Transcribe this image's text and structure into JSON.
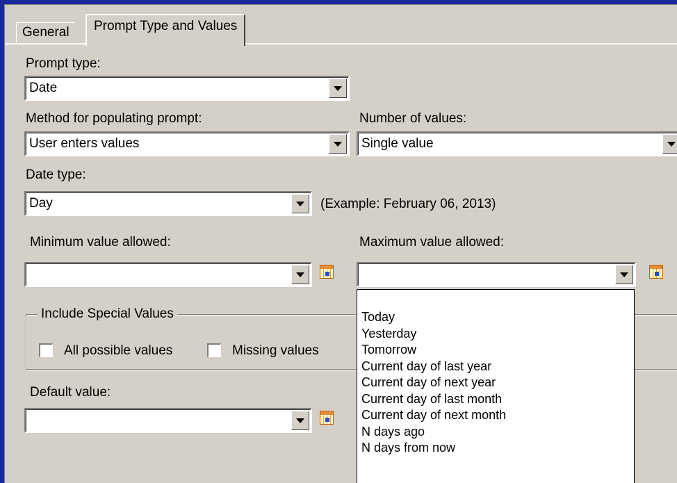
{
  "tabs": [
    {
      "label": "General",
      "active": false
    },
    {
      "label": "Prompt Type and Values",
      "active": true
    }
  ],
  "prompt_type": {
    "label": "Prompt type:",
    "value": "Date"
  },
  "method": {
    "label": "Method for populating prompt:",
    "value": "User enters values"
  },
  "number_of_values": {
    "label": "Number of values:",
    "value": "Single value"
  },
  "date_type": {
    "label": "Date type:",
    "value": "Day",
    "example": "(Example: February 06, 2013)"
  },
  "minimum": {
    "label": "Minimum value allowed:",
    "value": ""
  },
  "maximum": {
    "label": "Maximum value allowed:",
    "value": "",
    "options": [
      "Today",
      "Yesterday",
      "Tomorrow",
      "Current day of last year",
      "Current day of next year",
      "Current day of last month",
      "Current day of next month",
      "N days ago",
      "N days from now"
    ]
  },
  "special_values": {
    "legend": "Include Special Values",
    "all_possible": {
      "label": "All possible values",
      "checked": false
    },
    "missing": {
      "label": "Missing values",
      "checked": false
    }
  },
  "default_value": {
    "label": "Default value:",
    "value": ""
  },
  "icons": {
    "date_picker": "calendar-icon",
    "dropdown": "chevron-down-icon"
  }
}
